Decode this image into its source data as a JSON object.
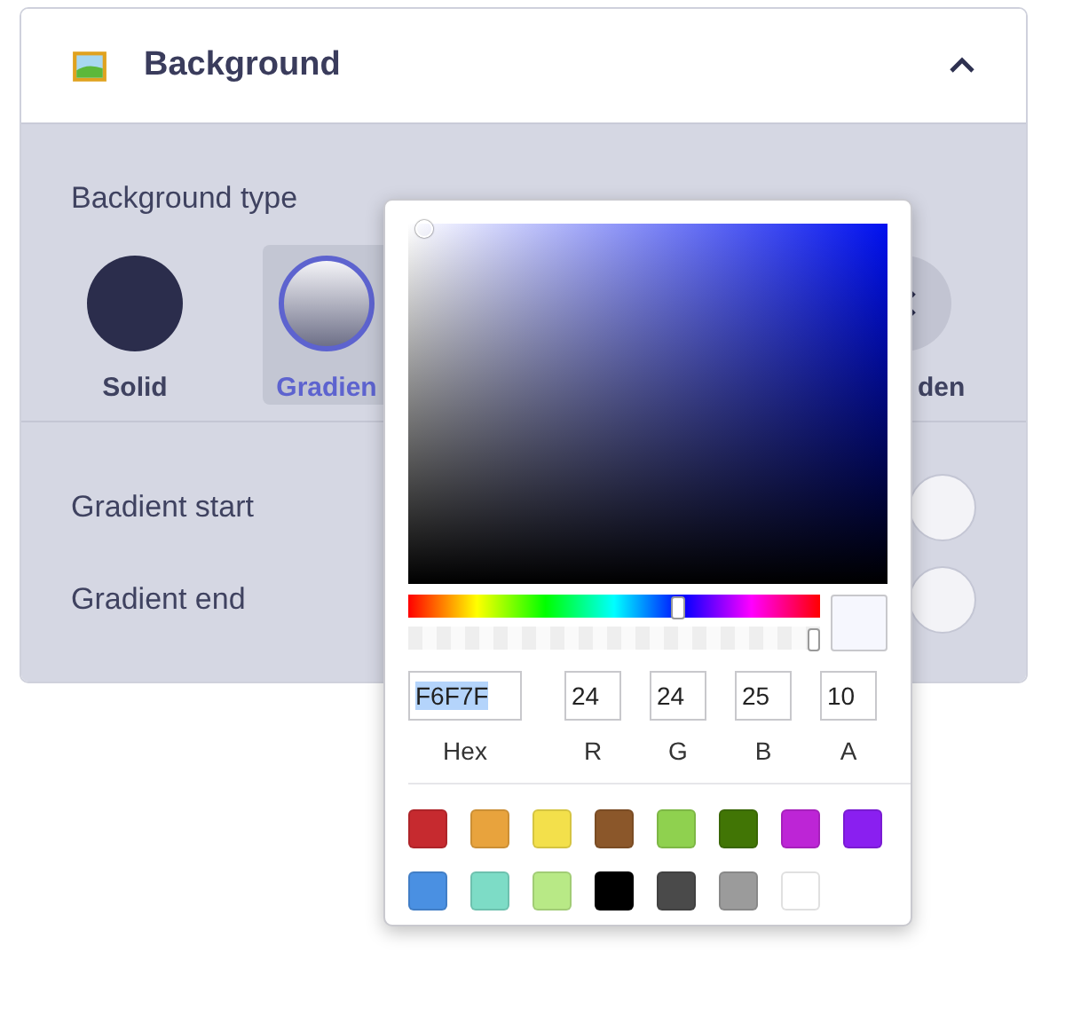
{
  "panel": {
    "title": "Background",
    "expanded": true
  },
  "background_type": {
    "label": "Background type",
    "options": [
      {
        "label": "Solid",
        "kind": "solid",
        "selected": false
      },
      {
        "label": "Gradien",
        "kind": "gradient",
        "selected": true
      },
      {
        "label": "den",
        "kind": "none",
        "selected": false
      }
    ]
  },
  "rows": [
    {
      "label": "Gradient start"
    },
    {
      "label": "Gradient end"
    }
  ],
  "color_picker": {
    "hue": {
      "level": 0.65
    },
    "alpha": {
      "level": 1.0
    },
    "fields": [
      {
        "label": "Hex",
        "value": "F6F7F",
        "text_selected": true
      },
      {
        "label": "R",
        "value": "24",
        "text_selected": false
      },
      {
        "label": "G",
        "value": "24",
        "text_selected": false
      },
      {
        "label": "B",
        "value": "25",
        "text_selected": false
      },
      {
        "label": "A",
        "value": "10",
        "text_selected": false
      }
    ],
    "swatches": [
      {
        "color": "#c62a2f"
      },
      {
        "color": "#e8a33d"
      },
      {
        "color": "#f3e04b"
      },
      {
        "color": "#8b572a"
      },
      {
        "color": "#8fd14f"
      },
      {
        "color": "#417505"
      },
      {
        "color": "#bd25d6"
      },
      {
        "color": "#8a1ff0"
      },
      {
        "color": "#4a90e2"
      },
      {
        "color": "#7ddcc6"
      },
      {
        "color": "#b8e986"
      },
      {
        "color": "#000000"
      },
      {
        "color": "#4a4a4a"
      },
      {
        "color": "#9b9b9b"
      },
      {
        "color": "#ffffff"
      }
    ]
  }
}
